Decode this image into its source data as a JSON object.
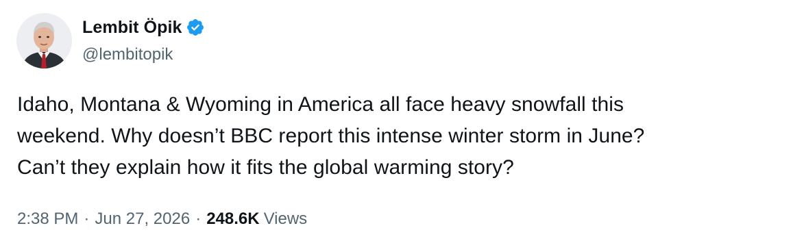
{
  "author": {
    "display_name": "Lembit Öpik",
    "handle": "@lembitopik",
    "verified": true,
    "verified_color": "#1d9bf0",
    "avatar_icon": "profile-photo"
  },
  "tweet": {
    "text": "Idaho, Montana & Wyoming in America all face heavy snowfall this\nweekend. Why doesn’t BBC report this intense winter storm in June?\nCan’t they explain how it fits the global warming story?"
  },
  "meta": {
    "time": "2:38 PM",
    "separator": "·",
    "date": "Jun 27, 2026",
    "views_count": "248.6K",
    "views_label": "Views"
  },
  "colors": {
    "text_primary": "#0f1419",
    "text_secondary": "#536471",
    "background": "#ffffff"
  }
}
